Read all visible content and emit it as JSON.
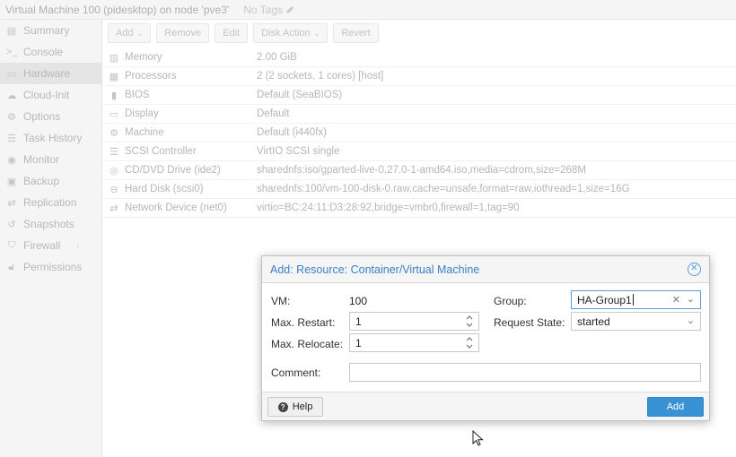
{
  "header": {
    "title": "Virtual Machine 100 (pidesktop) on node 'pve3'",
    "tags": "No Tags"
  },
  "sidebar": {
    "items": [
      {
        "label": "Summary",
        "icon": "book-icon"
      },
      {
        "label": "Console",
        "icon": "terminal-icon"
      },
      {
        "label": "Hardware",
        "icon": "monitor-icon",
        "active": true
      },
      {
        "label": "Cloud-Init",
        "icon": "cloud-icon"
      },
      {
        "label": "Options",
        "icon": "gear-icon"
      },
      {
        "label": "Task History",
        "icon": "list-icon"
      },
      {
        "label": "Monitor",
        "icon": "eye-icon"
      },
      {
        "label": "Backup",
        "icon": "floppy-icon"
      },
      {
        "label": "Replication",
        "icon": "retweet-icon"
      },
      {
        "label": "Snapshots",
        "icon": "history-icon"
      },
      {
        "label": "Firewall",
        "icon": "shield-icon"
      },
      {
        "label": "Permissions",
        "icon": "unlock-icon"
      }
    ]
  },
  "toolbar": {
    "add": "Add",
    "remove": "Remove",
    "edit": "Edit",
    "disk_action": "Disk Action",
    "revert": "Revert"
  },
  "hardware": [
    {
      "name": "Memory",
      "value": "2.00 GiB",
      "icon": "memory-icon"
    },
    {
      "name": "Processors",
      "value": "2 (2 sockets, 1 cores) [host]",
      "icon": "cpu-icon"
    },
    {
      "name": "BIOS",
      "value": "Default (SeaBIOS)",
      "icon": "microchip-icon"
    },
    {
      "name": "Display",
      "value": "Default",
      "icon": "desktop-icon"
    },
    {
      "name": "Machine",
      "value": "Default (i440fx)",
      "icon": "cogs-icon"
    },
    {
      "name": "SCSI Controller",
      "value": "VirtIO SCSI single",
      "icon": "database-icon"
    },
    {
      "name": "CD/DVD Drive (ide2)",
      "value": "sharednfs:iso/gparted-live-0.27.0-1-amd64.iso,media=cdrom,size=268M",
      "icon": "cdrom-icon"
    },
    {
      "name": "Hard Disk (scsi0)",
      "value": "sharednfs:100/vm-100-disk-0.raw,cache=unsafe,format=raw,iothread=1,size=16G",
      "icon": "hdd-icon"
    },
    {
      "name": "Network Device (net0)",
      "value": "virtio=BC:24:11:D3:28:92,bridge=vmbr0,firewall=1,tag=90",
      "icon": "exchange-icon"
    }
  ],
  "dialog": {
    "title": "Add: Resource: Container/Virtual Machine",
    "vm_label": "VM:",
    "vm_value": "100",
    "max_restart_label": "Max. Restart:",
    "max_restart_value": "1",
    "max_relocate_label": "Max. Relocate:",
    "max_relocate_value": "1",
    "group_label": "Group:",
    "group_value": "HA-Group1",
    "request_state_label": "Request State:",
    "request_state_value": "started",
    "comment_label": "Comment:",
    "comment_value": "",
    "help_label": "Help",
    "add_label": "Add"
  },
  "colors": {
    "accent": "#3892d4",
    "title_blue": "#3c7fc6"
  }
}
